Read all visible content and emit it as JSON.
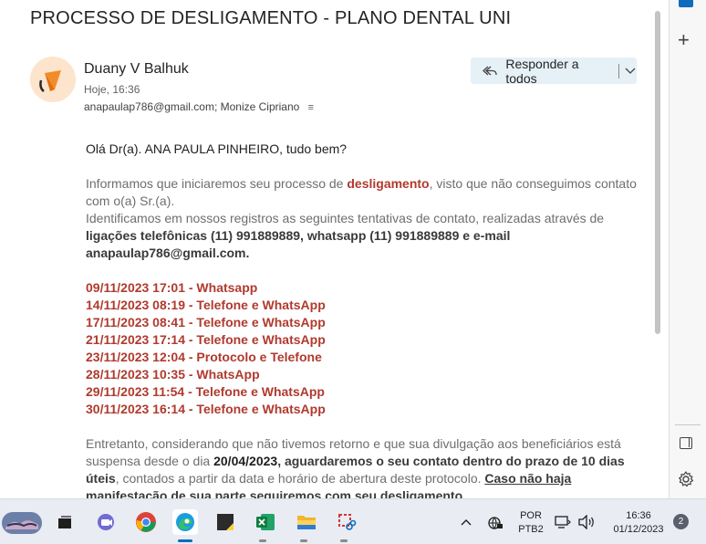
{
  "email": {
    "subject": "PROCESSO DE DESLIGAMENTO - PLANO DENTAL UNI",
    "sender": "Duany V Balhuk",
    "time": "Hoje, 16:36",
    "recipients": "anapaulap786@gmail.com; Monize Cipriano",
    "reply_all_label": "Responder a todos",
    "greeting": "Olá Dr(a). ANA PAULA PINHEIRO, tudo bem?",
    "p1_a": "Informamos que iniciaremos seu processo de ",
    "p1_b": "desligamento",
    "p1_c": ", visto que não conseguimos contato com o(a) Sr.(a).",
    "p2_a": "Identificamos em nossos registros as seguintes tentativas de contato, realizadas através de ",
    "p2_b": "ligações telefônicas (11) 991889889, whatsapp (11) 991889889 e e-mail anapaulap786@gmail.com.",
    "attempts": [
      "09/11/2023 17:01 - Whatsapp",
      "14/11/2023 08:19 - Telefone e WhatsApp",
      "17/11/2023 08:41 - Telefone e WhatsApp",
      "21/11/2023 17:14 - Telefone e WhatsApp",
      "23/11/2023 12:04 - Protocolo e Telefone",
      "28/11/2023 10:35 - WhatsApp",
      "29/11/2023 11:54 - Telefone e WhatsApp",
      "30/11/2023 16:14 - Telefone e WhatsApp"
    ],
    "p3_a": "Entretanto, considerando que não tivemos retorno e que sua divulgação aos beneficiários está suspensa desde o dia ",
    "p3_date": "20/04/2023",
    "p3_b": ", aguardaremos o seu contato dentro do prazo de 10 dias úteis",
    "p3_c": ", contados a partir da data e horário de abertura deste protocolo. ",
    "p3_d": "Caso não haja manifestação de sua parte seguiremos com seu desligamento"
  },
  "taskbar": {
    "lang_top": "POR",
    "lang_bottom": "PTB2",
    "clock_time": "16:36",
    "clock_date": "01/12/2023",
    "notification_count": "2"
  },
  "colors": {
    "accent": "#0f6cbd",
    "highlight_red": "#b03a2e",
    "reply_bg": "#e6f0f7"
  }
}
